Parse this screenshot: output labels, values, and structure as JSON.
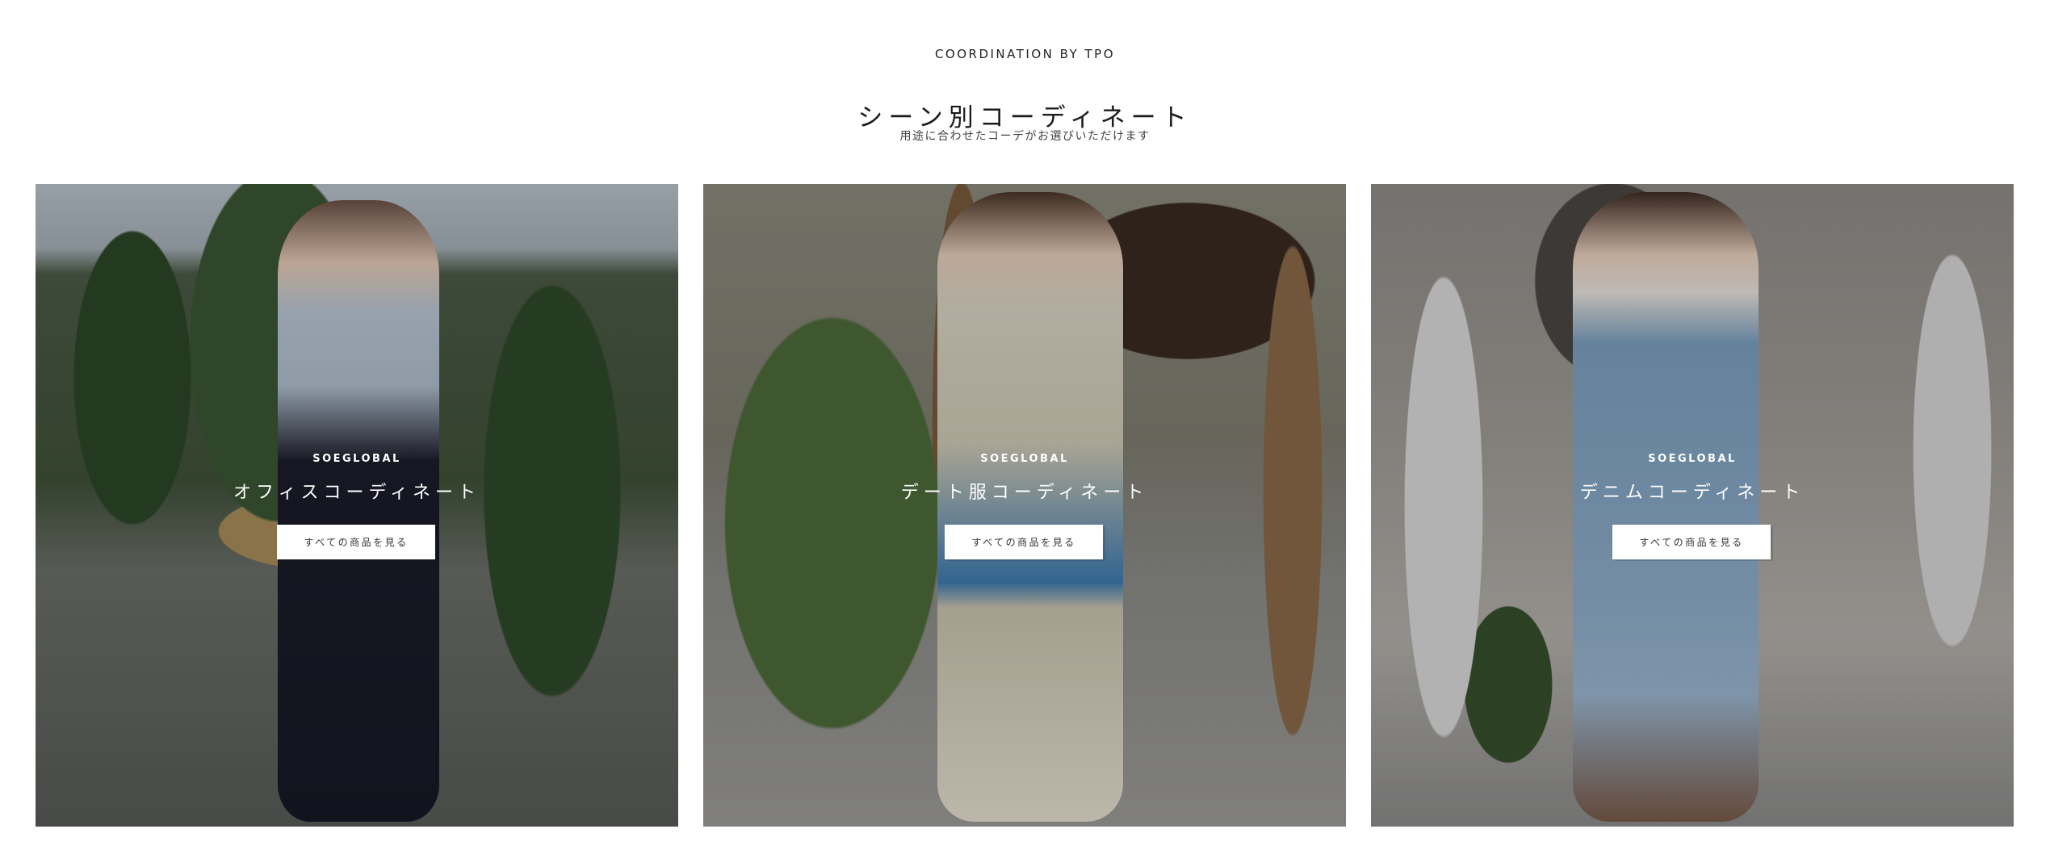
{
  "section": {
    "eyebrow": "COORDINATION BY TPO",
    "title": "シーン別コーディネート",
    "subtitle": "用途に合わせたコーデがお選びいただけます"
  },
  "cards": [
    {
      "brand": "SOEGLOBAL",
      "title": "オフィスコーディネート",
      "button_label": "すべての商品を見る"
    },
    {
      "brand": "SOEGLOBAL",
      "title": "デート服コーディネート",
      "button_label": "すべての商品を見る"
    },
    {
      "brand": "SOEGLOBAL",
      "title": "デニムコーディネート",
      "button_label": "すべての商品を見る"
    }
  ],
  "colors": {
    "background": "#ffffff",
    "text": "#222222",
    "button_bg": "#ffffff",
    "overlay_text": "#ffffff"
  }
}
